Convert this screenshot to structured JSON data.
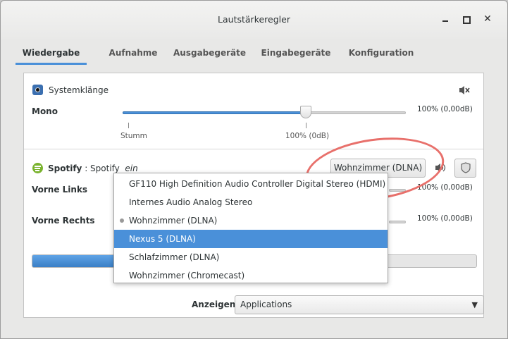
{
  "window": {
    "title": "Lautstärkeregler"
  },
  "tabs": [
    {
      "label": "Wiedergabe",
      "active": true
    },
    {
      "label": "Aufnahme",
      "active": false
    },
    {
      "label": "Ausgabegeräte",
      "active": false
    },
    {
      "label": "Eingabegeräte",
      "active": false
    },
    {
      "label": "Konfiguration",
      "active": false
    }
  ],
  "system_sounds": {
    "label": "Systemklänge",
    "channel_label": "Mono",
    "volume_text": "100% (0,00dB)",
    "volume_percent": 100,
    "tick_min_label": "Stumm",
    "tick_100_label": "100% (0dB)",
    "icon": "speaker-mute-icon"
  },
  "spotify": {
    "app_label": "Spotify",
    "separator": " : ",
    "stream_label": "Spotify",
    "stream_state": "ein",
    "output_button_label": "Wohnzimmer (DLNA)",
    "channels": [
      {
        "label": "Vorne Links",
        "volume_text": "100% (0,00dB)"
      },
      {
        "label": "Vorne Rechts",
        "volume_text": "100% (0,00dB)"
      }
    ],
    "level_percent": 30
  },
  "output_menu": {
    "items": [
      {
        "label": "GF110 High Definition Audio Controller Digital Stereo (HDMI)",
        "active": false,
        "highlighted": false
      },
      {
        "label": "Internes Audio Analog Stereo",
        "active": false,
        "highlighted": false
      },
      {
        "label": "Wohnzimmer (DLNA)",
        "active": true,
        "highlighted": false
      },
      {
        "label": "Nexus 5 (DLNA)",
        "active": false,
        "highlighted": true
      },
      {
        "label": "Schlafzimmer (DLNA)",
        "active": false,
        "highlighted": false
      },
      {
        "label": "Wohnzimmer (Chromecast)",
        "active": false,
        "highlighted": false
      }
    ]
  },
  "footer": {
    "show_label": "Anzeigen:",
    "show_value": "Applications"
  },
  "colors": {
    "accent": "#4a90d9",
    "annotation": "#e8706b"
  }
}
